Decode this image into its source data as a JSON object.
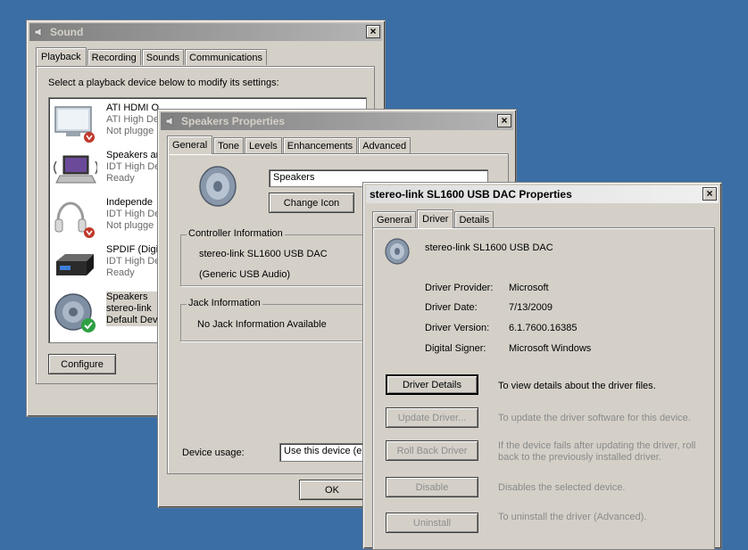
{
  "sound": {
    "title": "Sound",
    "tabs": [
      "Playback",
      "Recording",
      "Sounds",
      "Communications"
    ],
    "instruction": "Select a playback device below to modify its settings:",
    "devices": [
      {
        "name": "ATI HDMI Output",
        "name_visible": "ATI HDMI O",
        "line2": "ATI High De",
        "line3": "Not plugge",
        "icon": "monitor-icon",
        "status": "unplugged"
      },
      {
        "name": "Speakers and Headphones",
        "name_visible": "Speakers an",
        "line2": "IDT High De",
        "line3": "Ready",
        "icon": "laptop-icon",
        "status": "ready"
      },
      {
        "name": "Independent Headphones",
        "name_visible": "Independe",
        "line2": "IDT High De",
        "line3": "Not pluggе",
        "icon": "headphones-icon",
        "status": "unplugged"
      },
      {
        "name": "SPDIF (Digital Out)",
        "name_visible": "SPDIF (Digi",
        "line2": "IDT High De",
        "line3": "Ready",
        "icon": "spdif-box-icon",
        "status": "ready"
      },
      {
        "name": "Speakers",
        "name_visible": "Speakers",
        "line2": "stereo-link",
        "line3": "Default Dev",
        "icon": "speaker-icon",
        "status": "default"
      }
    ],
    "configure_label": "Configure"
  },
  "speakers_props": {
    "title": "Speakers Properties",
    "tabs": [
      "General",
      "Tone",
      "Levels",
      "Enhancements",
      "Advanced"
    ],
    "name_value": "Speakers",
    "change_icon_label": "Change Icon",
    "controller_group": "Controller Information",
    "controller_name": "stereo-link SL1600 USB DAC",
    "controller_sub": "(Generic USB Audio)",
    "jack_group": "Jack Information",
    "jack_text": "No Jack Information Available",
    "device_usage_label": "Device usage:",
    "device_usage_value": "Use this device (er",
    "ok_label": "OK"
  },
  "dac_props": {
    "title": "stereo-link SL1600 USB DAC Properties",
    "tabs": [
      "General",
      "Driver",
      "Details"
    ],
    "device_name": "stereo-link SL1600 USB DAC",
    "fields": [
      {
        "label": "Driver Provider:",
        "value": "Microsoft"
      },
      {
        "label": "Driver Date:",
        "value": "7/13/2009"
      },
      {
        "label": "Driver Version:",
        "value": "6.1.7600.16385"
      },
      {
        "label": "Digital Signer:",
        "value": "Microsoft Windows"
      }
    ],
    "actions": [
      {
        "button": "Driver Details",
        "desc": "To view details about the driver files.",
        "desc2": "",
        "enabled": true
      },
      {
        "button": "Update Driver...",
        "desc": "To update the driver software for this device.",
        "desc2": "",
        "enabled": false
      },
      {
        "button": "Roll Back Driver",
        "desc": "If the device fails after updating the driver, roll",
        "desc2": "back to the previously installed driver.",
        "enabled": false
      },
      {
        "button": "Disable",
        "desc": "Disables the selected device.",
        "desc2": "",
        "enabled": false
      },
      {
        "button": "Uninstall",
        "desc": "To uninstall the driver (Advanced).",
        "desc2": "",
        "enabled": false
      }
    ]
  },
  "colors": {
    "desktop": "#3a6ea5",
    "window_face": "#d4d0c8",
    "unplugged_badge": "#c0392b",
    "default_badge": "#2ea043"
  }
}
